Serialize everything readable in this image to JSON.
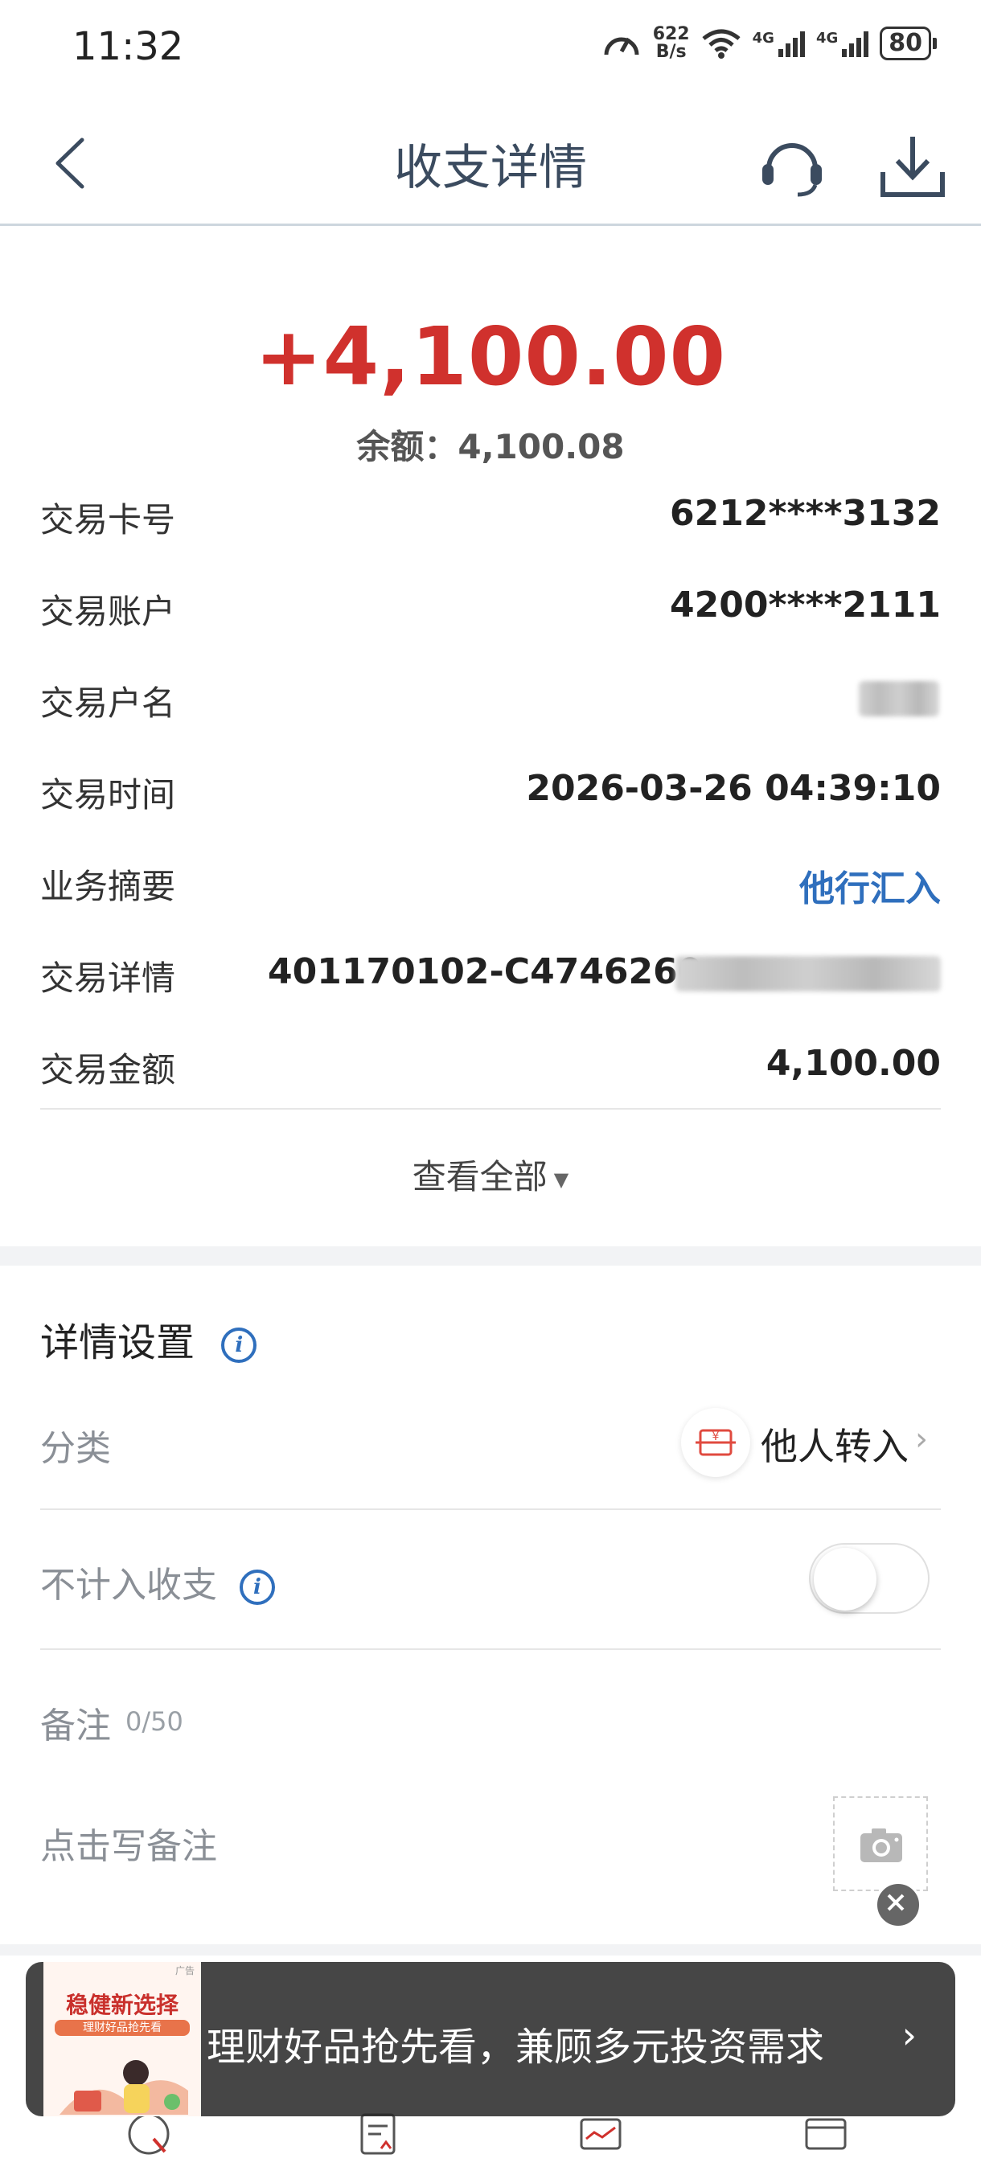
{
  "status_bar": {
    "time": "11:32",
    "net_speed_value": "622",
    "net_speed_unit": "B/s",
    "network_1": "4G",
    "network_2": "4G",
    "battery": "80"
  },
  "header": {
    "title": "收支详情"
  },
  "transaction": {
    "amount": "+4,100.00",
    "balance": "余额：4,100.08",
    "amount_color": "#d0312d"
  },
  "details": [
    {
      "label": "交易卡号",
      "value": "6212****3132"
    },
    {
      "label": "交易账户",
      "value": "4200****2111"
    },
    {
      "label": "交易户名",
      "value": ""
    },
    {
      "label": "交易时间",
      "value": "2026-03-26 04:39:10"
    },
    {
      "label": "业务摘要",
      "value": "他行汇入"
    },
    {
      "label": "交易详情",
      "value": "401170102-C4746260"
    },
    {
      "label": "交易金额",
      "value": "4,100.00"
    }
  ],
  "view_all": "查看全部",
  "settings": {
    "title": "详情设置",
    "category_label": "分类",
    "category_value": "他人转入",
    "exclude_label": "不计入收支",
    "exclude_enabled": false,
    "remark_label": "备注",
    "remark_count": "0/50",
    "remark_placeholder": "点击写备注"
  },
  "ad": {
    "image_title": "稳健新选择",
    "image_subtitle": "理财好品抢先看",
    "tag": "广告",
    "text": "理财好品抢先看，兼顾多元投资需求"
  },
  "colors": {
    "accent_blue": "#2f6fbd",
    "amount_red": "#d0312d"
  }
}
